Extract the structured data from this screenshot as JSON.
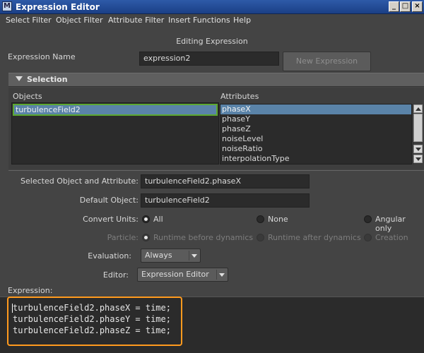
{
  "window": {
    "title": "Expression Editor",
    "icon": "maya-icon"
  },
  "menubar": [
    "Select Filter",
    "Object Filter",
    "Attribute Filter",
    "Insert Functions",
    "Help"
  ],
  "header": {
    "status": "Editing Expression"
  },
  "expression_name": {
    "label": "Expression Name",
    "value": "expression2"
  },
  "new_expression_button": "New Expression",
  "selection": {
    "title": "Selection",
    "objects_header": "Objects",
    "attributes_header": "Attributes",
    "objects": [
      "turbulenceField2"
    ],
    "attributes": [
      "phaseX",
      "phaseY",
      "phaseZ",
      "noiseLevel",
      "noiseRatio",
      "interpolationType"
    ],
    "selected_attribute": "phaseX"
  },
  "form": {
    "selected_obj_attr_label": "Selected Object and Attribute:",
    "selected_obj_attr_value": "turbulenceField2.phaseX",
    "default_object_label": "Default Object:",
    "default_object_value": "turbulenceField2",
    "convert_units_label": "Convert Units:",
    "convert_units_options": [
      "All",
      "None",
      "Angular only"
    ],
    "convert_units_selected": "All",
    "particle_label": "Particle:",
    "particle_options": [
      "Runtime before dynamics",
      "Runtime after dynamics",
      "Creation"
    ],
    "evaluation_label": "Evaluation:",
    "evaluation_value": "Always",
    "editor_label": "Editor:",
    "editor_value": "Expression Editor"
  },
  "expression": {
    "label": "Expression:",
    "lines": [
      "turbulenceField2.phaseX = time;",
      "turbulenceField2.phaseY = time;",
      "turbulenceField2.phaseZ = time;"
    ],
    "highlight_color": "#ff9a1e"
  },
  "colors": {
    "selection_blue": "#5a83a8",
    "object_outline": "#5ca830",
    "titlebar": "#2e5aa8"
  }
}
